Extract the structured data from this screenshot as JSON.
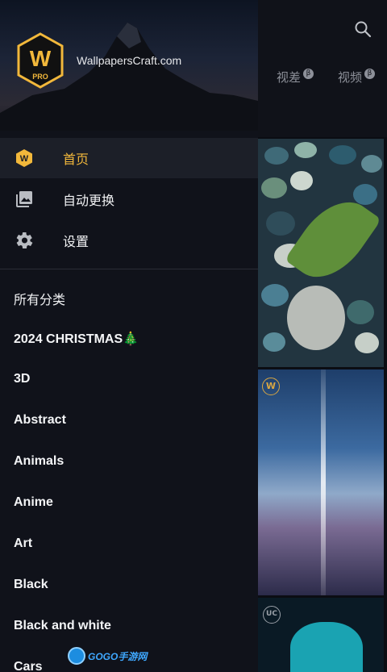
{
  "header": {
    "site_name": "WallpapersCraft.com",
    "logo_letter": "W",
    "logo_badge": "PRO"
  },
  "background_app": {
    "tabs": [
      {
        "label": "视差",
        "badge": "β"
      },
      {
        "label": "视频",
        "badge": "β"
      }
    ],
    "tile_badges": [
      "W",
      "UC"
    ]
  },
  "menu": {
    "items": [
      {
        "label": "首页",
        "icon": "wallpapers-logo-icon",
        "active": true
      },
      {
        "label": "自动更换",
        "icon": "image-stack-icon",
        "active": false
      },
      {
        "label": "设置",
        "icon": "gear-icon",
        "active": false
      }
    ]
  },
  "categories": {
    "title": "所有分类",
    "items": [
      "2024 CHRISTMAS🎄",
      "3D",
      "Abstract",
      "Animals",
      "Anime",
      "Art",
      "Black",
      "Black and white",
      "Cars"
    ]
  },
  "watermark": {
    "text": "GOGO手游网"
  },
  "colors": {
    "accent": "#f2b83b",
    "drawer_bg": "#10121a",
    "active_bg": "#1c1f28"
  }
}
